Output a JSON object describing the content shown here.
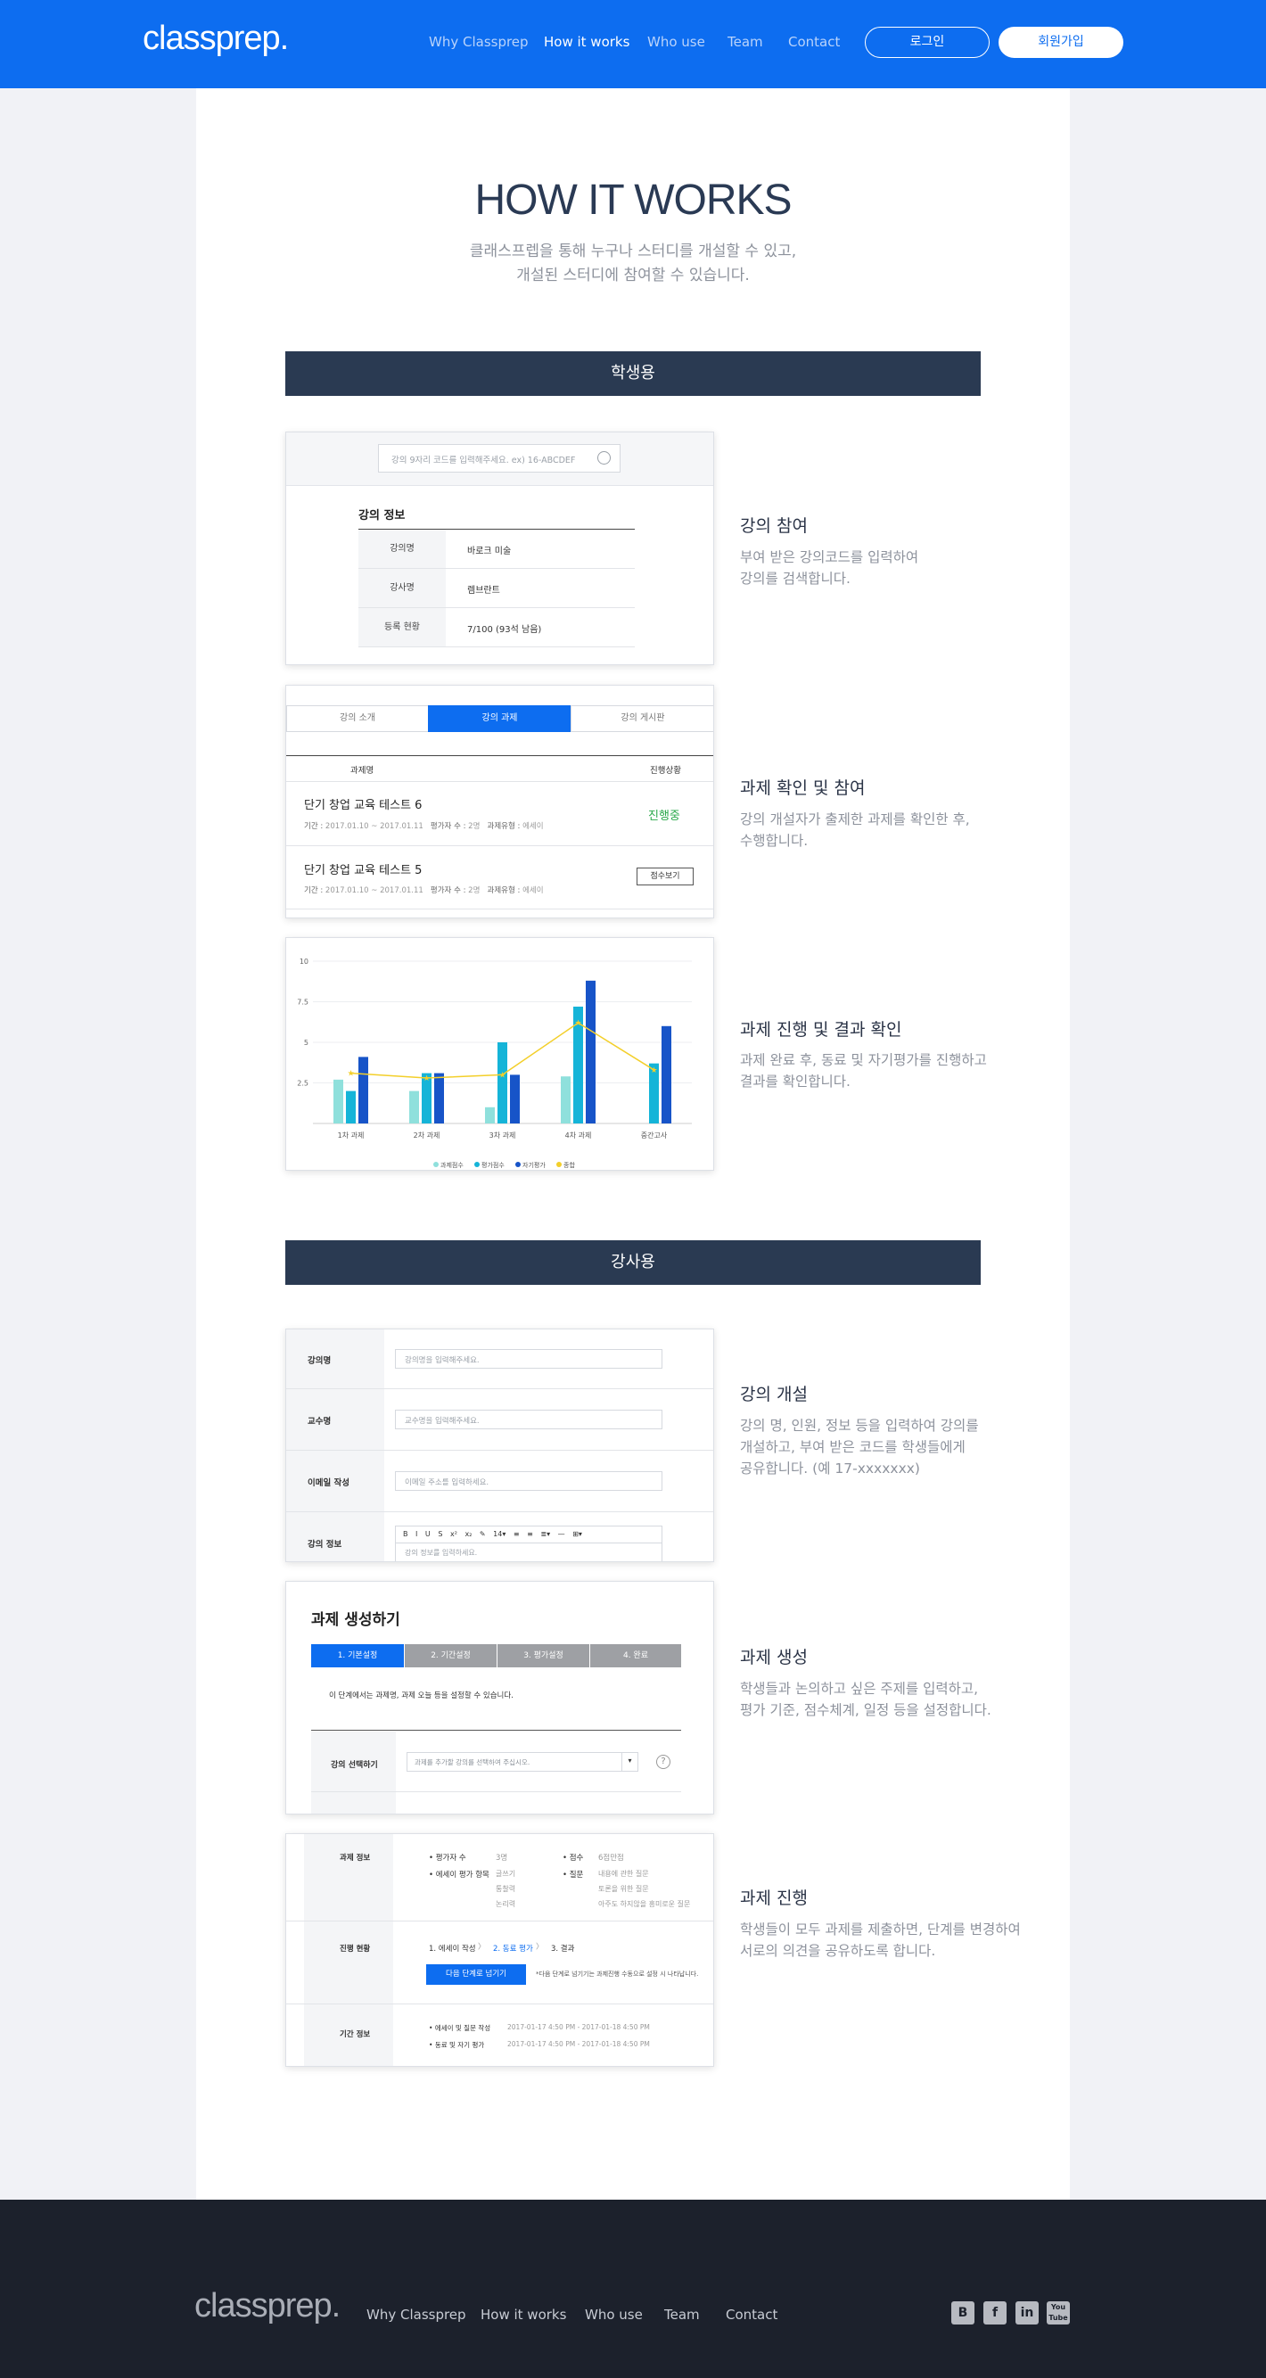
{
  "header": {
    "logo": "classprep.",
    "nav": [
      "Why Classprep",
      "How it works",
      "Who use",
      "Team",
      "Contact"
    ],
    "login": "로그인",
    "signup": "회원가입"
  },
  "hero": {
    "title": "HOW IT WORKS",
    "sub1": "클래스프렙을 통해 누구나 스터디를 개설할 수 있고,",
    "sub2": "개설된 스터디에 참여할 수 있습니다."
  },
  "students_bar": "학생용",
  "teachers_bar": "강사용",
  "colors": {
    "brand": "#0d6df0",
    "dark": "#2a3a52",
    "footer": "#1c212c"
  },
  "s1": {
    "search_placeholder": "강의 9자리 코드를 입력해주세요. ex) 16-ABCDEF",
    "info_title": "강의 정보",
    "rows": [
      [
        "강의명",
        "바로크 미술"
      ],
      [
        "강사명",
        "렘브란트"
      ],
      [
        "등록 현황",
        "7/100 (93석 남음)"
      ]
    ],
    "title": "강의 참여",
    "desc": "부여 받은 강의코드를 입력하여\n강의를 검색합니다."
  },
  "s2": {
    "tabs": [
      "강의 소개",
      "강의 과제",
      "강의 게시판"
    ],
    "col1": "과제명",
    "col2": "진행상황",
    "items": [
      {
        "name": "단기 창업 교육 테스트 6",
        "period_label": "기간 :",
        "period": "2017.01.10 ~ 2017.01.11",
        "eval_label": "평가자 수 :",
        "eval": "2명",
        "type_label": "과제유형 :",
        "type": "에세이",
        "status": "진행중"
      },
      {
        "name": "단기 창업 교육 테스트 5",
        "period_label": "기간 :",
        "period": "2017.01.10 ~ 2017.01.11",
        "eval_label": "평가자 수 :",
        "eval": "2명",
        "type_label": "과제유형 :",
        "type": "에세이",
        "status": "점수보기"
      }
    ],
    "title": "과제 확인 및 참여",
    "desc": "강의 개설자가 출제한 과제를 확인한 후,\n수행합니다."
  },
  "chart_data": {
    "type": "bar",
    "categories": [
      "1차 과제",
      "2차 과제",
      "3차 과제",
      "4차 과제",
      "중간고사"
    ],
    "ylim": [
      0,
      10
    ],
    "yticks": [
      "10",
      "7.5",
      "5",
      "2.5"
    ],
    "series": [
      {
        "name": "과제점수",
        "values": [
          2.7,
          2.0,
          1.0,
          2.9,
          0
        ]
      },
      {
        "name": "평가점수",
        "values": [
          2.0,
          3.1,
          5.0,
          7.2,
          3.7
        ]
      },
      {
        "name": "자기평가",
        "values": [
          4.1,
          3.1,
          3.0,
          8.8,
          6.0
        ]
      },
      {
        "name": "종합",
        "values": [
          3.1,
          2.8,
          3.0,
          6.2,
          3.3
        ]
      }
    ],
    "colors": [
      "#8fe0dc",
      "#15b4d8",
      "#1754c8",
      "#f3cf2a"
    ]
  },
  "s3": {
    "title": "과제 진행 및 결과 확인",
    "desc": "과제 완료 후, 동료 및 자기평가를 진행하고\n결과를 확인합니다."
  },
  "t1": {
    "rows": [
      {
        "label": "강의명",
        "ph": "강의명을 입력해주세요."
      },
      {
        "label": "교수명",
        "ph": "교수명을 입력해주세요."
      },
      {
        "label": "이메일 작성",
        "ph": "이메일 주소를 입력하세요."
      },
      {
        "label": "강의 정보",
        "ph": "강의 정보를 입력하세요."
      }
    ],
    "toolbar": [
      "B",
      "I",
      "U",
      "S",
      "x²",
      "x₂",
      "✎",
      "14▾",
      "≡",
      "≡",
      "≣▾",
      "—",
      "⊞▾"
    ],
    "title": "강의 개설",
    "desc": "강의 명, 인원, 정보 등을 입력하여 강의를\n개설하고, 부여 받은 코드를 학생들에게\n공유합니다. (예 17-xxxxxxx)"
  },
  "t2": {
    "heading": "과제 생성하기",
    "steps": [
      "1. 기본설정",
      "2. 기간설정",
      "3. 평가설정",
      "4. 완료"
    ],
    "note": "이 단계에서는 과제명, 과제 오늘 등을 설정할 수 있습니다.",
    "select_label": "강의 선택하기",
    "select_ph": "과제를 추가할 강의를 선택하여 주십시오.",
    "title": "과제 생성",
    "desc": "학생들과 논의하고 싶은 주제를 입력하고,\n평가 기준, 점수체계, 일정 등을 설정합니다."
  },
  "t3": {
    "info_label": "과제 정보",
    "evaluators_k": "평가자 수",
    "evaluators_v": "3명",
    "score_k": "점수",
    "score_v": "6점만점",
    "criteria_k": "에세이 평가 항목",
    "criteria_v": [
      "글쓰기",
      "통찰력",
      "논리력"
    ],
    "question_k": "질문",
    "question_v": [
      "내용에 관한 질문",
      "토론을 위한 질문",
      "아주도 하지않을 흥미로운 질문"
    ],
    "progress_label": "진행 현황",
    "steps": [
      "1. 에세이 작성",
      "2. 동료 평가",
      "3. 결과"
    ],
    "next_btn": "다음 단계로 넘기기",
    "next_note": "*다음 단계로 넘기기는 과제진행 수동으로 설정 시 나타납니다.",
    "period_label": "기간 정보",
    "periods": [
      {
        "k": "에세이 및 질문 작성",
        "v": "2017-01-17 4:50 PM - 2017-01-18 4:50 PM"
      },
      {
        "k": "동료 및 자기 평가",
        "v": "2017-01-17 4:50 PM - 2017-01-18 4:50 PM"
      }
    ],
    "title": "과제 진행",
    "desc": "학생들이 모두 과제를 제출하면, 단계를 변경하여\n서로의 의견을 공유하도록 합니다."
  },
  "footer": {
    "logo": "classprep.",
    "nav": [
      "Why Classprep",
      "How it works",
      "Who use",
      "Team",
      "Contact"
    ],
    "social": [
      "blogger-icon",
      "facebook-icon",
      "linkedin-icon",
      "youtube-icon"
    ]
  }
}
